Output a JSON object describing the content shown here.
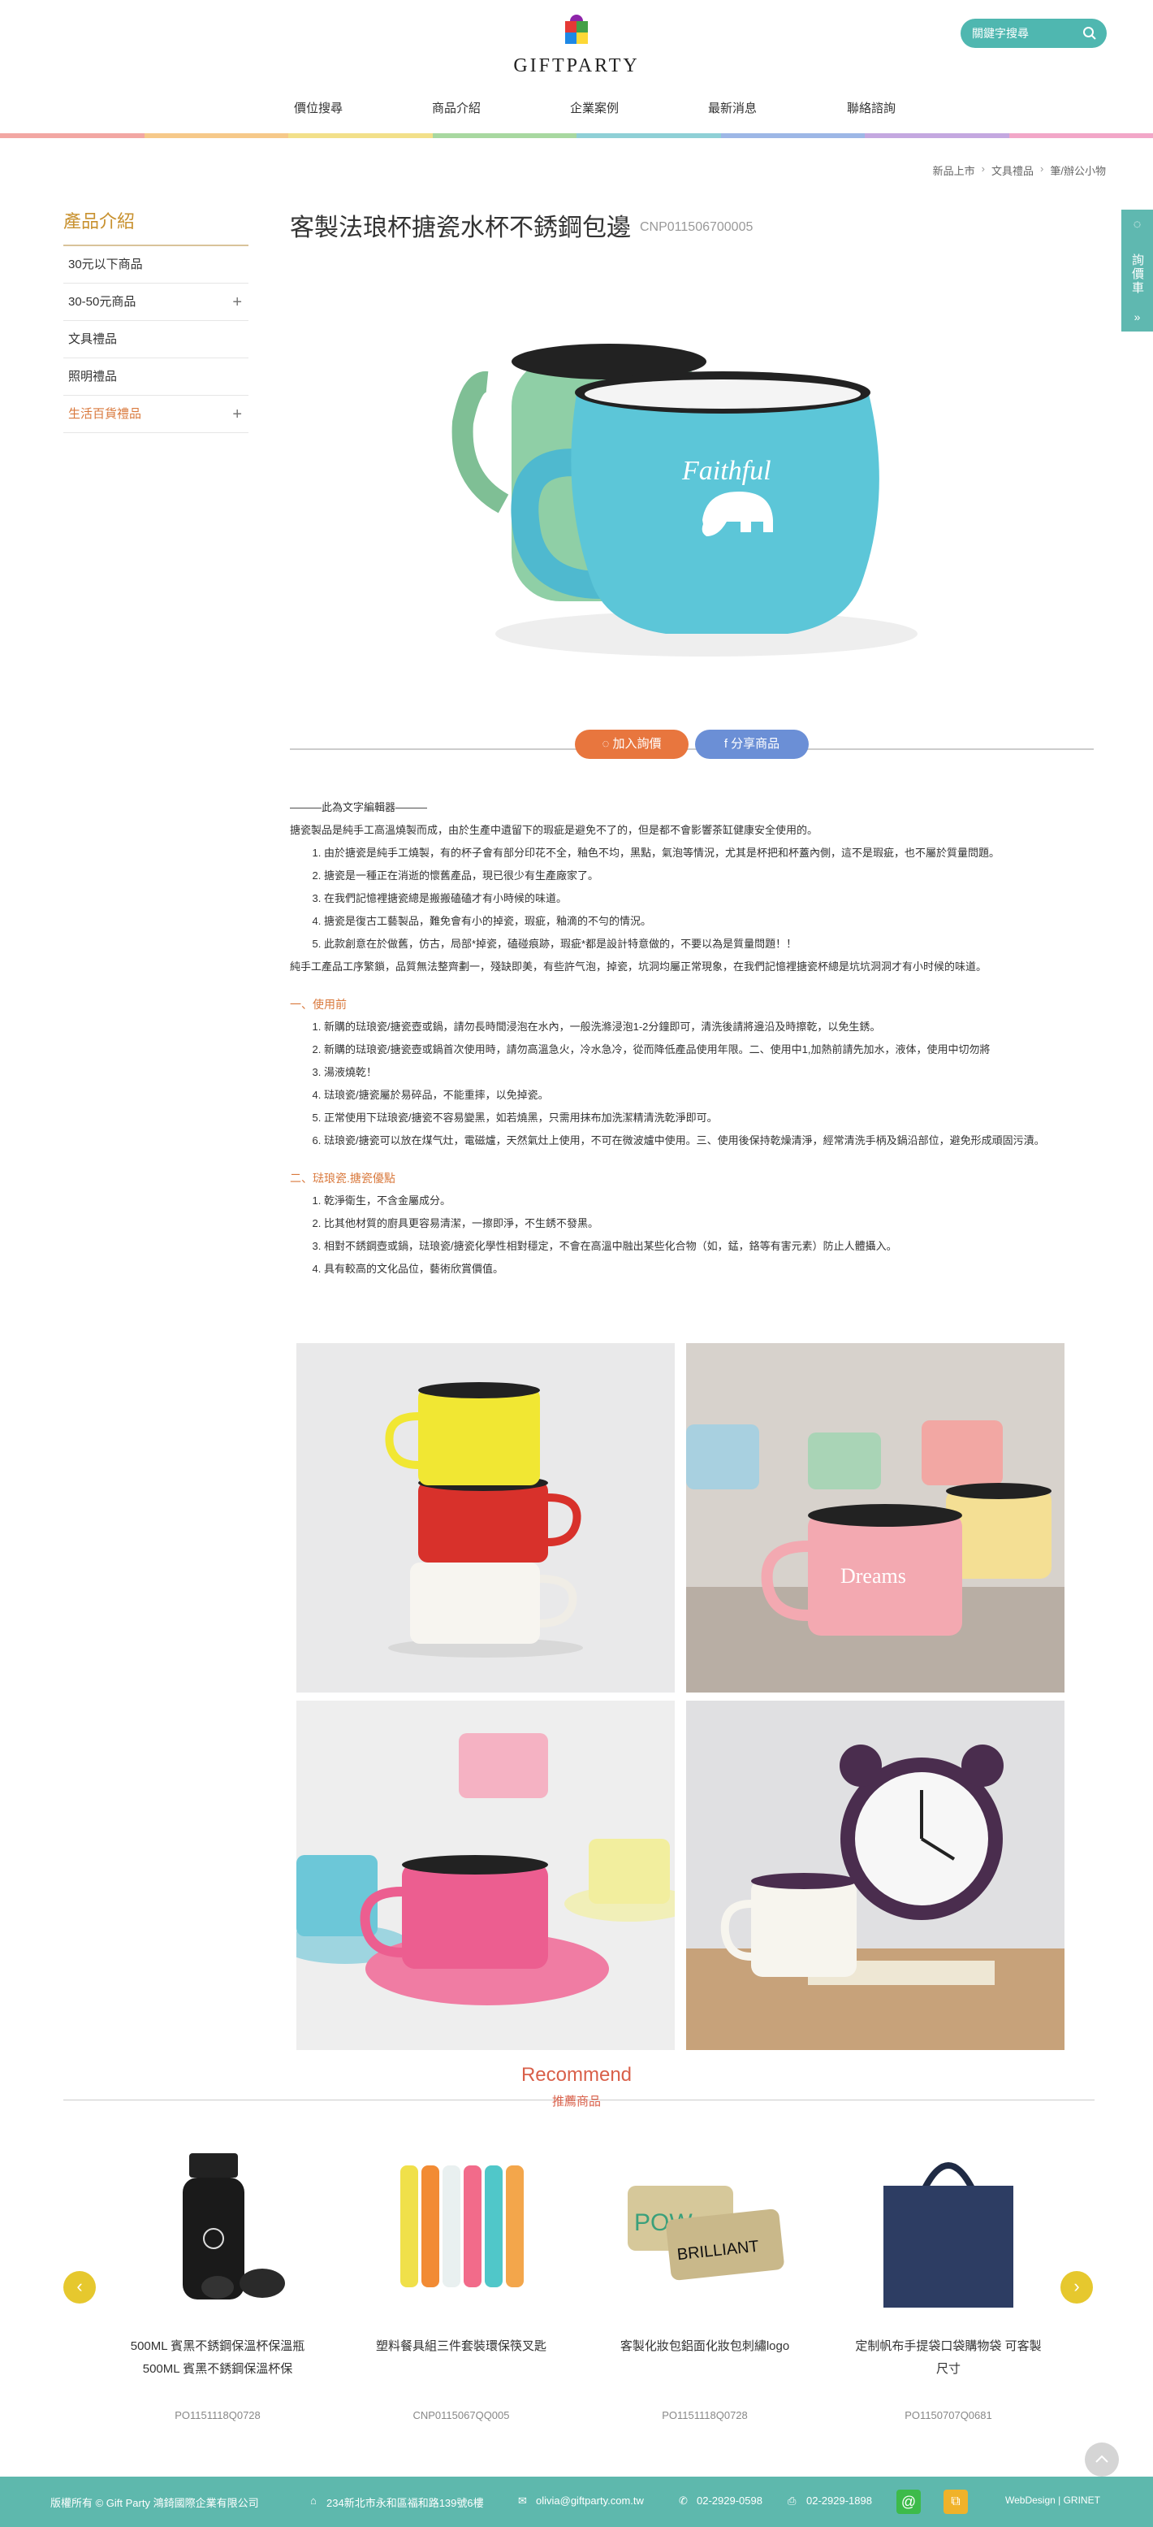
{
  "header": {
    "logo_text": "GIFTPARTY",
    "search_placeholder": "關鍵字搜尋",
    "nav": [
      "價位搜尋",
      "商品介紹",
      "企業案例",
      "最新消息",
      "聯絡諮詢"
    ],
    "rainbow_colors": [
      "#f2a7a3",
      "#f6c98a",
      "#f2e08a",
      "#a8d8a0",
      "#8fd0d6",
      "#9db7e6",
      "#c4a8e0",
      "#f2a7c8"
    ]
  },
  "breadcrumb": [
    "新品上市",
    "文具禮品",
    "筆/辦公小物"
  ],
  "sidebar": {
    "title": "產品介紹",
    "items": [
      {
        "label": "30元以下商品",
        "expandable": false,
        "active": false
      },
      {
        "label": "30-50元商品",
        "expandable": true,
        "active": false
      },
      {
        "label": "文具禮品",
        "expandable": false,
        "active": false
      },
      {
        "label": "照明禮品",
        "expandable": false,
        "active": false
      },
      {
        "label": "生活百貨禮品",
        "expandable": true,
        "active": true
      }
    ],
    "plus_symbol": "+"
  },
  "product": {
    "title": "客製法琅杯搪瓷水杯不銹鋼包邊",
    "code": "CNP011506700005",
    "mug_text": "Faithful",
    "inquiry_label": "加入詢價",
    "share_label": "分享商品"
  },
  "description": {
    "editor_note": "———此為文字編輯器———",
    "intro": "搪瓷製品是純手工高溫燒製而成，由於生產中遺留下的瑕疵是避免不了的，但是都不會影響茶缸健康安全使用的。",
    "intro_list": [
      "由於搪瓷是純手工燒製，有的杯子會有部分印花不全，釉色不均，黑點，氣泡等情況，尤其是杯把和杯蓋內側，這不是瑕疵，也不屬於質量問題。",
      "搪瓷是一種正在消逝的懷舊產品，現已很少有生產廠家了。",
      "在我們記憶裡搪瓷總是搬搬磕磕才有小時候的味道。",
      "搪瓷是復古工藝製品，難免會有小的掉瓷，瑕疵，釉滴的不勻的情況。",
      "此款創意在於做舊，仿古，局部*掉瓷，磕碰痕跡，瑕疵*都是設計特意做的，不要以為是質量問題！！"
    ],
    "closing": "純手工產品工序繁鎖，品質無法整齊劃一，殘缺即美，有些許气泡，掉瓷，坑洞均屬正常現象，在我們記憶裡搪瓷杯總是坑坑洞洞才有小时候的味道。",
    "section1_title": "一、使用前",
    "section1_list": [
      "新購的琺琅瓷/搪瓷壺或鍋，請勿長時間浸泡在水內，一般洗滌浸泡1-2分鐘即可，清洗後請將邊沿及時擦乾，以免生銹。",
      "新購的琺琅瓷/搪瓷壺或鍋首次使用時，請勿高溫急火，冷水急冷，從而降低產品使用年限。二、使用中1,加熱前請先加水，液体，使用中切勿將",
      "湯液燒乾！",
      "琺琅瓷/搪瓷屬於易碎品，不能重摔，以免掉瓷。",
      "正常使用下琺琅瓷/搪瓷不容易變黑，如若燒黑，只需用抹布加洗潔精清洗乾淨即可。",
      "琺琅瓷/搪瓷可以放在煤气灶，電磁爐，天然氣灶上使用，不可在微波爐中使用。三、使用後保持乾燥清淨，經常清洗手柄及鍋沿部位，避免形成頑固污漬。"
    ],
    "section2_title": "二、琺琅瓷.搪瓷優點",
    "section2_list": [
      "乾淨衛生，不含金屬成分。",
      "比其他材質的廚具更容易清潔，一擦即淨，不生銹不發黑。",
      "相對不銹鋼壺或鍋，琺琅瓷/搪瓷化學性相對穩定，不會在高溫中融出某些化合物（如，錳，鉻等有害元素）防止人體攝入。",
      "具有較高的文化品位，藝術欣賞價值。"
    ],
    "photos": [
      {
        "alt": "stacked-mugs",
        "label": ""
      },
      {
        "alt": "pastel-mugs",
        "label": "Dreams"
      },
      {
        "alt": "polka-dot-mugs",
        "label": ""
      },
      {
        "alt": "mug-with-clock",
        "label": ""
      }
    ]
  },
  "recommend": {
    "title_en": "Recommend",
    "title_zh": "推薦商品",
    "prev": "‹",
    "next": "›",
    "items": [
      {
        "name": "500ML 賓黑不銹鋼保溫杯保溫瓶500ML 賓黑不銹鋼保溫杯保",
        "code": "PO1151118Q0728"
      },
      {
        "name": "塑料餐具組三件套裝環保筷叉匙",
        "code": "CNP0115067QQ005"
      },
      {
        "name": "客製化妝包鋁面化妝包刺繡logo",
        "code": "PO1151118Q0728"
      },
      {
        "name": "定制帆布手提袋口袋購物袋 可客製尺寸",
        "code": "PO1150707Q0681"
      }
    ],
    "cosmetic_text": [
      "POW",
      "BRILLIANT"
    ]
  },
  "side_tab": {
    "label": "詢價車",
    "arrow": "»"
  },
  "footer": {
    "copyright": "版權所有 © Gift Party 鴻錡國際企業有限公司",
    "address": "234新北市永和區福和路139號6樓",
    "email": "olivia@giftparty.com.tw",
    "phone": "02-2929-0598",
    "fax": "02-2929-1898",
    "credit": "WebDesign | GRINET"
  }
}
